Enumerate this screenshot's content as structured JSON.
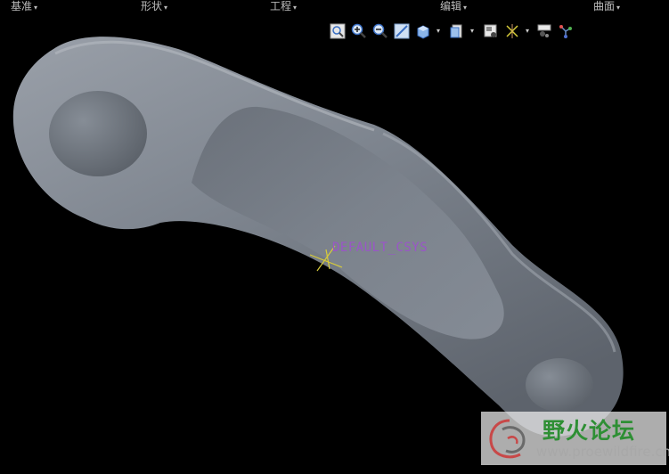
{
  "menu": [
    {
      "label": "基准"
    },
    {
      "label": "形状"
    },
    {
      "label": "工程"
    },
    {
      "label": "编辑"
    },
    {
      "label": "曲面"
    }
  ],
  "menu_caret": "▾",
  "toolbar_icons": [
    "zoom-fit-icon",
    "zoom-in-icon",
    "zoom-out-icon",
    "repaint-icon",
    "saved-orientation-icon",
    "display-style-icon",
    "view-manager-icon",
    "datum-display-icon",
    "annotation-display-icon",
    "spin-center-icon"
  ],
  "viewport": {
    "csys_label": "DEFAULT_CSYS",
    "model_color": "#7d848e",
    "csys_color": "#d8cc3a",
    "background": "#000000"
  },
  "watermark": {
    "title": "野火论坛",
    "url": "www.proewildfire.cn"
  }
}
